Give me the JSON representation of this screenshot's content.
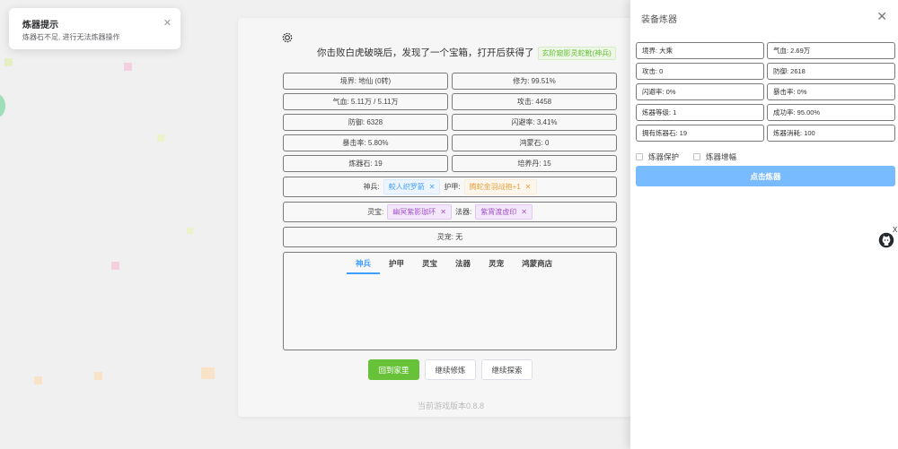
{
  "story": {
    "text": "你击败白虎破晓后，发现了一个宝箱，打开后获得了",
    "loot": "玄阶窥影灵蛇靴(神兵)"
  },
  "stats": [
    "境界: 地仙 (0转)",
    "修为: 99.51%",
    "气血: 5.11万 / 5.11万",
    "攻击: 4458",
    "防御: 6328",
    "闪避率: 3.41%",
    "暴击率: 5.80%",
    "鸿蒙石: 0",
    "炼器石: 19",
    "培养丹: 15"
  ],
  "equip": {
    "weapon_label": "神兵:",
    "weapon": "鲛人织罗箭",
    "armor_label": "护甲:",
    "armor": "腾蛇金羽战袍+1",
    "treasure_label": "灵宝:",
    "treasure": "幽冥紫影珈环",
    "magic_label": "法器:",
    "magic": "紫霄渡虚印",
    "pet": "灵宠: 无"
  },
  "tabs": [
    "神兵",
    "护甲",
    "灵宝",
    "法器",
    "灵宠",
    "鸿蒙商店"
  ],
  "buttons": {
    "home": "回到家里",
    "train": "继续修炼",
    "explore": "继续探索"
  },
  "version": "当前游戏版本0.8.8",
  "notification": {
    "title": "炼器提示",
    "message": "炼器石不足, 进行无法炼器操作"
  },
  "drawer": {
    "title": "装备炼器",
    "stats": [
      "境界: 大乘",
      "气血: 2.69万",
      "攻击: 0",
      "防御: 2618",
      "闪避率: 0%",
      "暴击率: 0%",
      "炼器等级: 1",
      "成功率: 95.00%",
      "拥有炼器石: 19",
      "炼器消耗: 100"
    ],
    "protect": "炼器保护",
    "boost": "炼器增幅",
    "refine": "点击炼器"
  },
  "side_close": "X",
  "colors": {
    "primary": "#409eff",
    "success": "#67c23a",
    "refine_button": "#79bbff"
  }
}
